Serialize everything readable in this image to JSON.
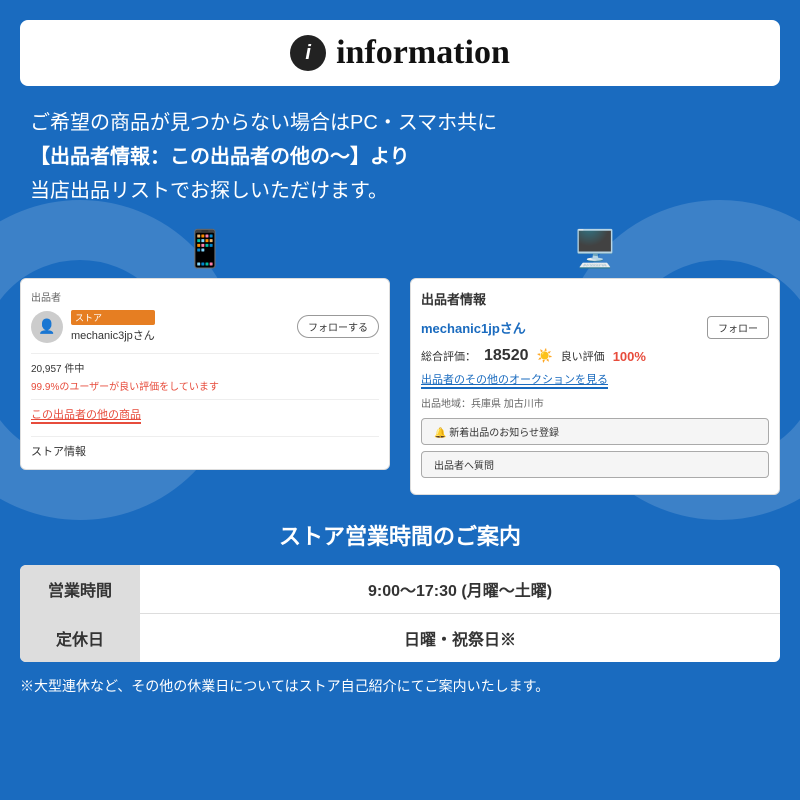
{
  "header": {
    "icon_label": "i",
    "title": "information"
  },
  "main_text": {
    "line1": "ご希望の商品が見つからない場合はPC・スマホ共に",
    "line2": "【出品者情報：この出品者の他の〜】より",
    "line3": "当店出品リストでお探しいただけます。"
  },
  "mobile_screenshot": {
    "seller_section_label": "出品者",
    "store_badge": "ストア",
    "seller_name": "mechanic3jpさん",
    "follow_button": "フォローする",
    "count": "20,957 件中",
    "positive_rate": "99.9%のユーザーが良い評価をしています",
    "other_items_link": "この出品者の他の商品",
    "store_info": "ストア情報"
  },
  "pc_screenshot": {
    "section_title": "出品者情報",
    "seller_name": "mechanic1jpさん",
    "follow_button": "フォロー",
    "rating_label": "総合評価：",
    "rating_score": "18520",
    "rating_positive_label": "良い評価",
    "rating_pct": "100%",
    "auction_link": "出品者のその他のオークションを見る",
    "location_label": "出品地域：兵庫県 加古川市",
    "new_items_btn": "🔔 新着出品のお知らせ登録",
    "question_btn": "出品者へ質問"
  },
  "hours_section": {
    "title": "ストア営業時間のご案内",
    "rows": [
      {
        "label": "営業時間",
        "value": "9:00〜17:30 (月曜〜土曜)"
      },
      {
        "label": "定休日",
        "value": "日曜・祝祭日※"
      }
    ],
    "note": "※大型連休など、その他の休業日についてはストア自己紹介にてご案内いたします。"
  },
  "device_icons": {
    "mobile": "📱",
    "pc": "💻"
  }
}
